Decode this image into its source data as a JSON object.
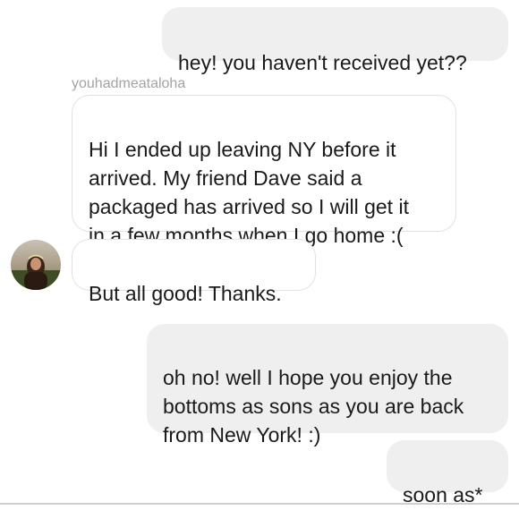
{
  "thread": {
    "messages": [
      {
        "direction": "outgoing",
        "text": "hey! you haven't received yet??"
      },
      {
        "direction": "incoming",
        "text": "Hi I ended up leaving NY before it\narrived. My friend Dave said a\npackaged has arrived so I will get it\nin a few months when I go home :("
      },
      {
        "direction": "incoming",
        "text": "But all good! Thanks."
      },
      {
        "direction": "outgoing",
        "text": "oh no! well I hope you enjoy the\nbottoms as sons as you are back\nfrom New York! :)"
      },
      {
        "direction": "outgoing",
        "text": "soon as*"
      }
    ],
    "sender_username": "youhadmeataloha"
  },
  "colors": {
    "outgoing_bubble": "#efefef",
    "incoming_bubble_border": "#e2e2e2",
    "username_text": "#a3a3a3",
    "message_text": "#1a1a1a"
  },
  "icons": {
    "avatar": "user-avatar-photo"
  }
}
